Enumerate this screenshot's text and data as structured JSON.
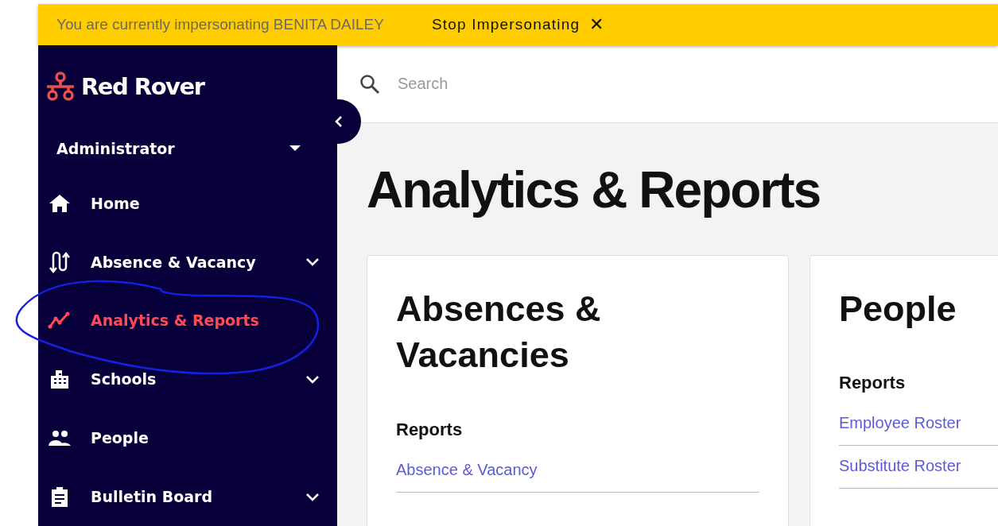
{
  "banner": {
    "message": "You are currently impersonating BENITA DAILEY",
    "action": "Stop Impersonating",
    "close": "✕"
  },
  "sidebar": {
    "brand": "Red Rover",
    "role": "Administrator",
    "items": [
      {
        "label": "Home",
        "kind": "home",
        "selected": false,
        "expandable": false
      },
      {
        "label": "Absence & Vacancy",
        "kind": "swap",
        "selected": false,
        "expandable": true
      },
      {
        "label": "Analytics & Reports",
        "kind": "chart",
        "selected": true,
        "expandable": false
      },
      {
        "label": "Schools",
        "kind": "building",
        "selected": false,
        "expandable": true
      },
      {
        "label": "People",
        "kind": "people",
        "selected": false,
        "expandable": false
      },
      {
        "label": "Bulletin Board",
        "kind": "clipboard",
        "selected": false,
        "expandable": true
      }
    ]
  },
  "search": {
    "placeholder": "Search"
  },
  "page_title": "Analytics & Reports",
  "cards": [
    {
      "title": "Absences & Vacancies",
      "section": "Reports",
      "links": [
        "Absence & Vacancy"
      ]
    },
    {
      "title": "People",
      "section": "Reports",
      "links": [
        "Employee Roster",
        "Substitute Roster"
      ]
    }
  ]
}
